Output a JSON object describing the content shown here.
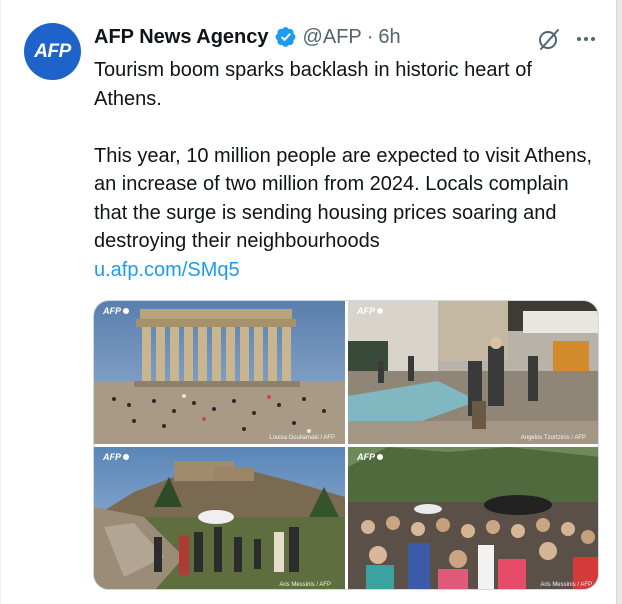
{
  "tweet": {
    "avatar_text": "AFP",
    "author_name": "AFP News Agency",
    "handle": "@AFP",
    "separator": "·",
    "time": "6h",
    "text_line1": "Tourism boom sparks backlash in historic heart of Athens.",
    "text_line2": "This year, 10 million people are expected to visit Athens, an increase of two million from 2024. Locals complain that the surge is sending housing prices soaring and destroying their neighbourhoods",
    "link": "u.afp.com/SMq5"
  },
  "icons": {
    "verified": "verified-badge-icon",
    "grok": "grok-icon",
    "more": "more-options-icon"
  },
  "media": {
    "images": [
      {
        "watermark": "AFP",
        "credit": "Louisa Gouliamaki / AFP"
      },
      {
        "watermark": "AFP",
        "credit": "Angelos Tzortzinis / AFP"
      },
      {
        "watermark": "AFP",
        "credit": "Aris Messinis / AFP"
      },
      {
        "watermark": "AFP",
        "credit": "Aris Messinis / AFP"
      }
    ]
  },
  "colors": {
    "brand_blue": "#1d63c9",
    "verified_blue": "#1d9bf0",
    "link_blue": "#1d9bf0",
    "secondary_text": "#536471",
    "primary_text": "#0f1419"
  }
}
